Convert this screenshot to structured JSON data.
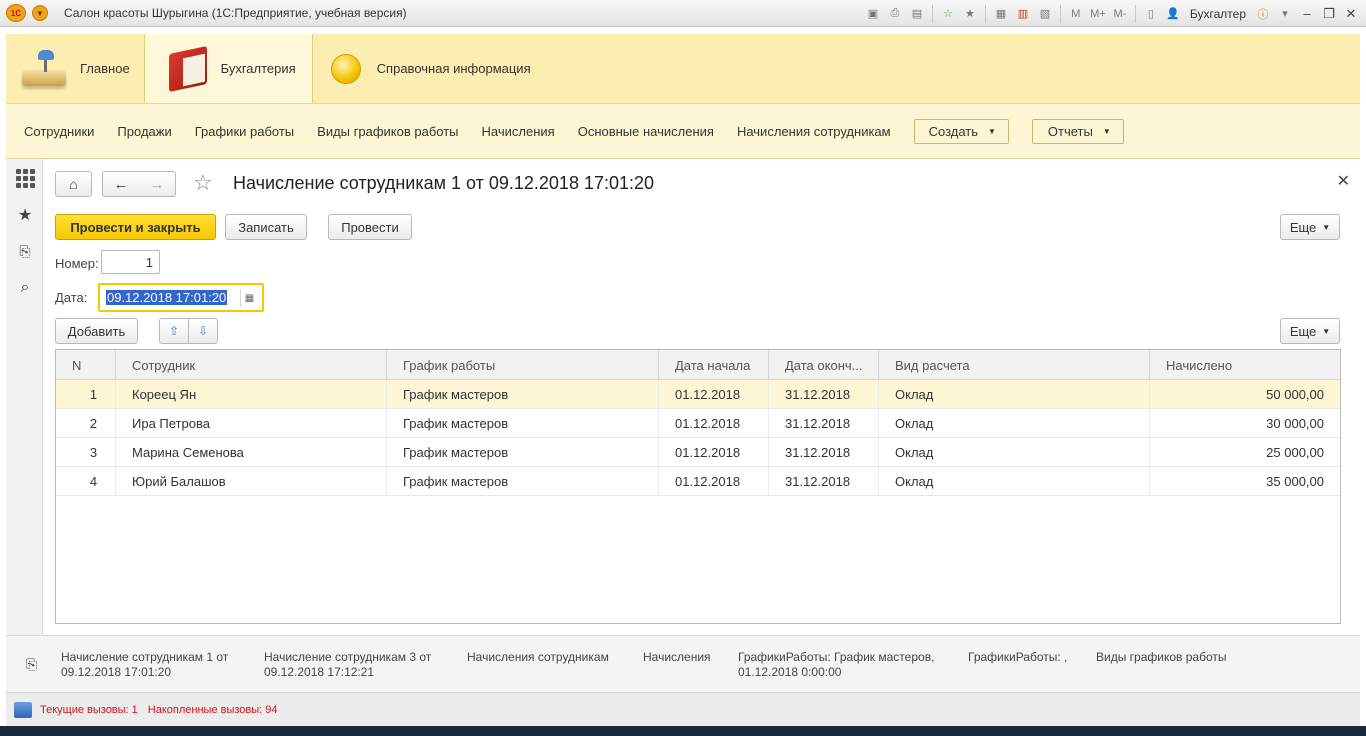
{
  "window": {
    "title": "Салон красоты Шурыгина  (1С:Предприятие, учебная версия)",
    "user": "Бухгалтер",
    "logo": "1C",
    "toolbar_letters": [
      "M",
      "M+",
      "M-"
    ]
  },
  "sections": [
    {
      "label": "Главное",
      "icon": "desk-lamp-icon"
    },
    {
      "label": "Бухгалтерия",
      "icon": "red-book-icon",
      "active": true
    },
    {
      "label": "Справочная информация",
      "icon": "gold-coin-icon"
    }
  ],
  "nav": {
    "links": [
      "Сотрудники",
      "Продажи",
      "Графики работы",
      "Виды графиков работы",
      "Начисления",
      "Основные начисления",
      "Начисления сотрудникам"
    ],
    "create_label": "Создать",
    "reports_label": "Отчеты"
  },
  "form": {
    "title": "Начисление сотрудникам 1 от 09.12.2018 17:01:20",
    "post_close_label": "Провести и закрыть",
    "save_label": "Записать",
    "post_label": "Провести",
    "more_label": "Еще",
    "number_label": "Номер:",
    "number_value": "1",
    "date_label": "Дата:",
    "date_value": "09.12.2018 17:01:20",
    "add_label": "Добавить",
    "table_more_label": "Еще"
  },
  "table": {
    "columns": [
      "N",
      "Сотрудник",
      "График работы",
      "Дата начала",
      "Дата оконч...",
      "Вид расчета",
      "Начислено"
    ],
    "rows": [
      {
        "n": "1",
        "employee": "Кореец Ян",
        "schedule": "График мастеров",
        "start": "01.12.2018",
        "end": "31.12.2018",
        "type": "Оклад",
        "amount": "50 000,00"
      },
      {
        "n": "2",
        "employee": "Ира Петрова",
        "schedule": "График мастеров",
        "start": "01.12.2018",
        "end": "31.12.2018",
        "type": "Оклад",
        "amount": "30 000,00"
      },
      {
        "n": "3",
        "employee": "Марина Семенова",
        "schedule": "График мастеров",
        "start": "01.12.2018",
        "end": "31.12.2018",
        "type": "Оклад",
        "amount": "25 000,00"
      },
      {
        "n": "4",
        "employee": "Юрий Балашов",
        "schedule": "График мастеров",
        "start": "01.12.2018",
        "end": "31.12.2018",
        "type": "Оклад",
        "amount": "35 000,00"
      }
    ]
  },
  "open_windows": [
    {
      "line1": "Начисление сотрудникам 1 от",
      "line2": "09.12.2018 17:01:20"
    },
    {
      "line1": "Начисление сотрудникам 3 от",
      "line2": "09.12.2018 17:12:21"
    },
    {
      "line1": "Начисления сотрудникам",
      "line2": ""
    },
    {
      "line1": "Начисления",
      "line2": ""
    },
    {
      "line1": "ГрафикиРаботы: График мастеров,",
      "line2": "01.12.2018 0:00:00"
    },
    {
      "line1": "ГрафикиРаботы: ,",
      "line2": ""
    },
    {
      "line1": "Виды графиков работы",
      "line2": ""
    }
  ],
  "status": {
    "current_calls": "Текущие вызовы: 1",
    "accumulated_calls": "Накопленные вызовы: 94"
  },
  "colors": {
    "sections_bg": "#fbeeb0",
    "primary_button": "#f5c800",
    "selected_row": "#fcf6d4",
    "status_text": "#d0141c"
  }
}
